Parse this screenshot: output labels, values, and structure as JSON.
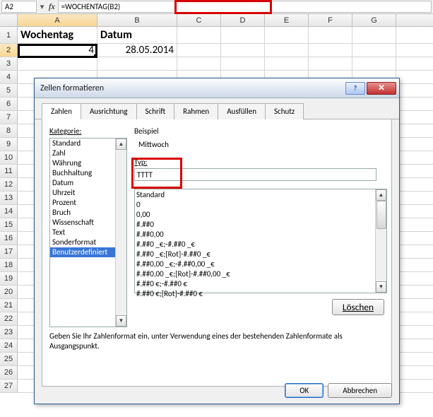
{
  "formula_bar": {
    "cell_ref": "A2",
    "fx": "fx",
    "formula": "=WOCHENTAG(B2)"
  },
  "columns": [
    "A",
    "B",
    "C",
    "D",
    "E",
    "F",
    "G"
  ],
  "rows": [
    "1",
    "2",
    "3",
    "4",
    "5",
    "6",
    "7",
    "8",
    "9",
    "10",
    "11",
    "12",
    "13",
    "14",
    "15",
    "16",
    "17",
    "18",
    "19",
    "20",
    "21",
    "22",
    "23",
    "24",
    "25",
    "26",
    "27"
  ],
  "sheet": {
    "A1": "Wochentag",
    "B1": "Datum",
    "A2": "4",
    "B2": "28.05.2014"
  },
  "dialog": {
    "title": "Zellen formatieren",
    "help": "?",
    "close": "✕",
    "tabs": [
      "Zahlen",
      "Ausrichtung",
      "Schrift",
      "Rahmen",
      "Ausfüllen",
      "Schutz"
    ],
    "kategorie_label": "Kategorie:",
    "categories": [
      "Standard",
      "Zahl",
      "Währung",
      "Buchhaltung",
      "Datum",
      "Uhrzeit",
      "Prozent",
      "Bruch",
      "Wissenschaft",
      "Text",
      "Sonderformat",
      "Benutzerdefiniert"
    ],
    "beispiel_label": "Beispiel",
    "beispiel_value": "Mittwoch",
    "typ_label": "Typ:",
    "typ_value": "TTTT",
    "formats": [
      "Standard",
      "0",
      "0,00",
      "#.##0",
      "#.##0,00",
      "#.##0 _€;-#.##0 _€",
      "#.##0 _€;[Rot]-#.##0 _€",
      "#.##0,00 _€;-#.##0,00 _€",
      "#.##0,00 _€;[Rot]-#.##0,00 _€",
      "#.##0 €;-#.##0 €",
      "#.##0 €;[Rot]-#.##0 €"
    ],
    "delete_label": "Löschen",
    "hint": "Geben Sie Ihr Zahlenformat ein, unter Verwendung eines der bestehenden Zahlenformate als Ausgangspunkt.",
    "ok": "OK",
    "cancel": "Abbrechen"
  }
}
